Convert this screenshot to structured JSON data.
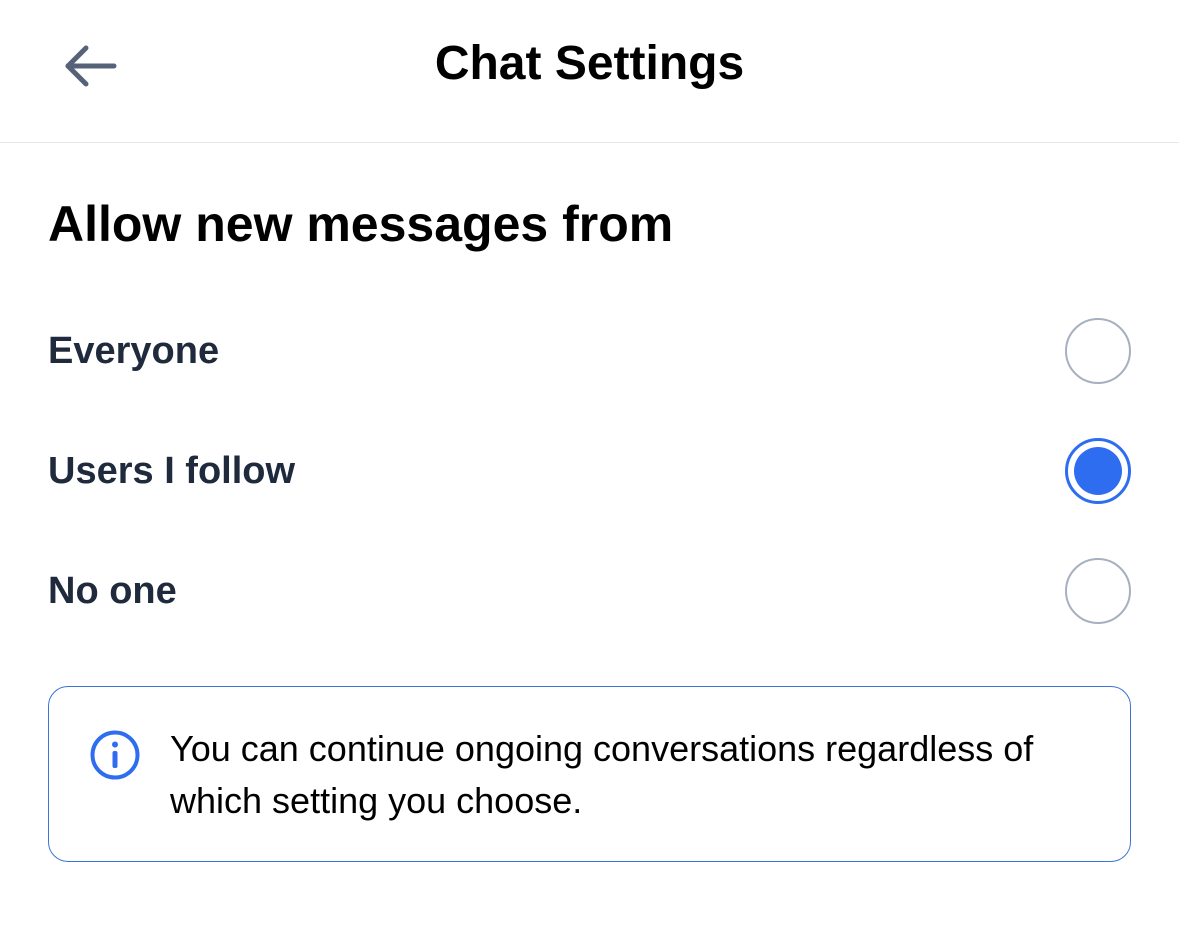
{
  "header": {
    "title": "Chat Settings",
    "back_icon": "arrow-left-icon"
  },
  "section": {
    "heading": "Allow new messages from"
  },
  "options": [
    {
      "label": "Everyone",
      "selected": false
    },
    {
      "label": "Users I follow",
      "selected": true
    },
    {
      "label": "No one",
      "selected": false
    }
  ],
  "info": {
    "icon": "info-circle-icon",
    "text": "You can continue ongoing conversations regardless of which setting you choose."
  },
  "colors": {
    "accent": "#2e6df0",
    "radio_border": "#a7b0c0",
    "text_primary": "#1f2a3d",
    "info_border": "#3a74d9",
    "divider": "#e6e8ec"
  }
}
